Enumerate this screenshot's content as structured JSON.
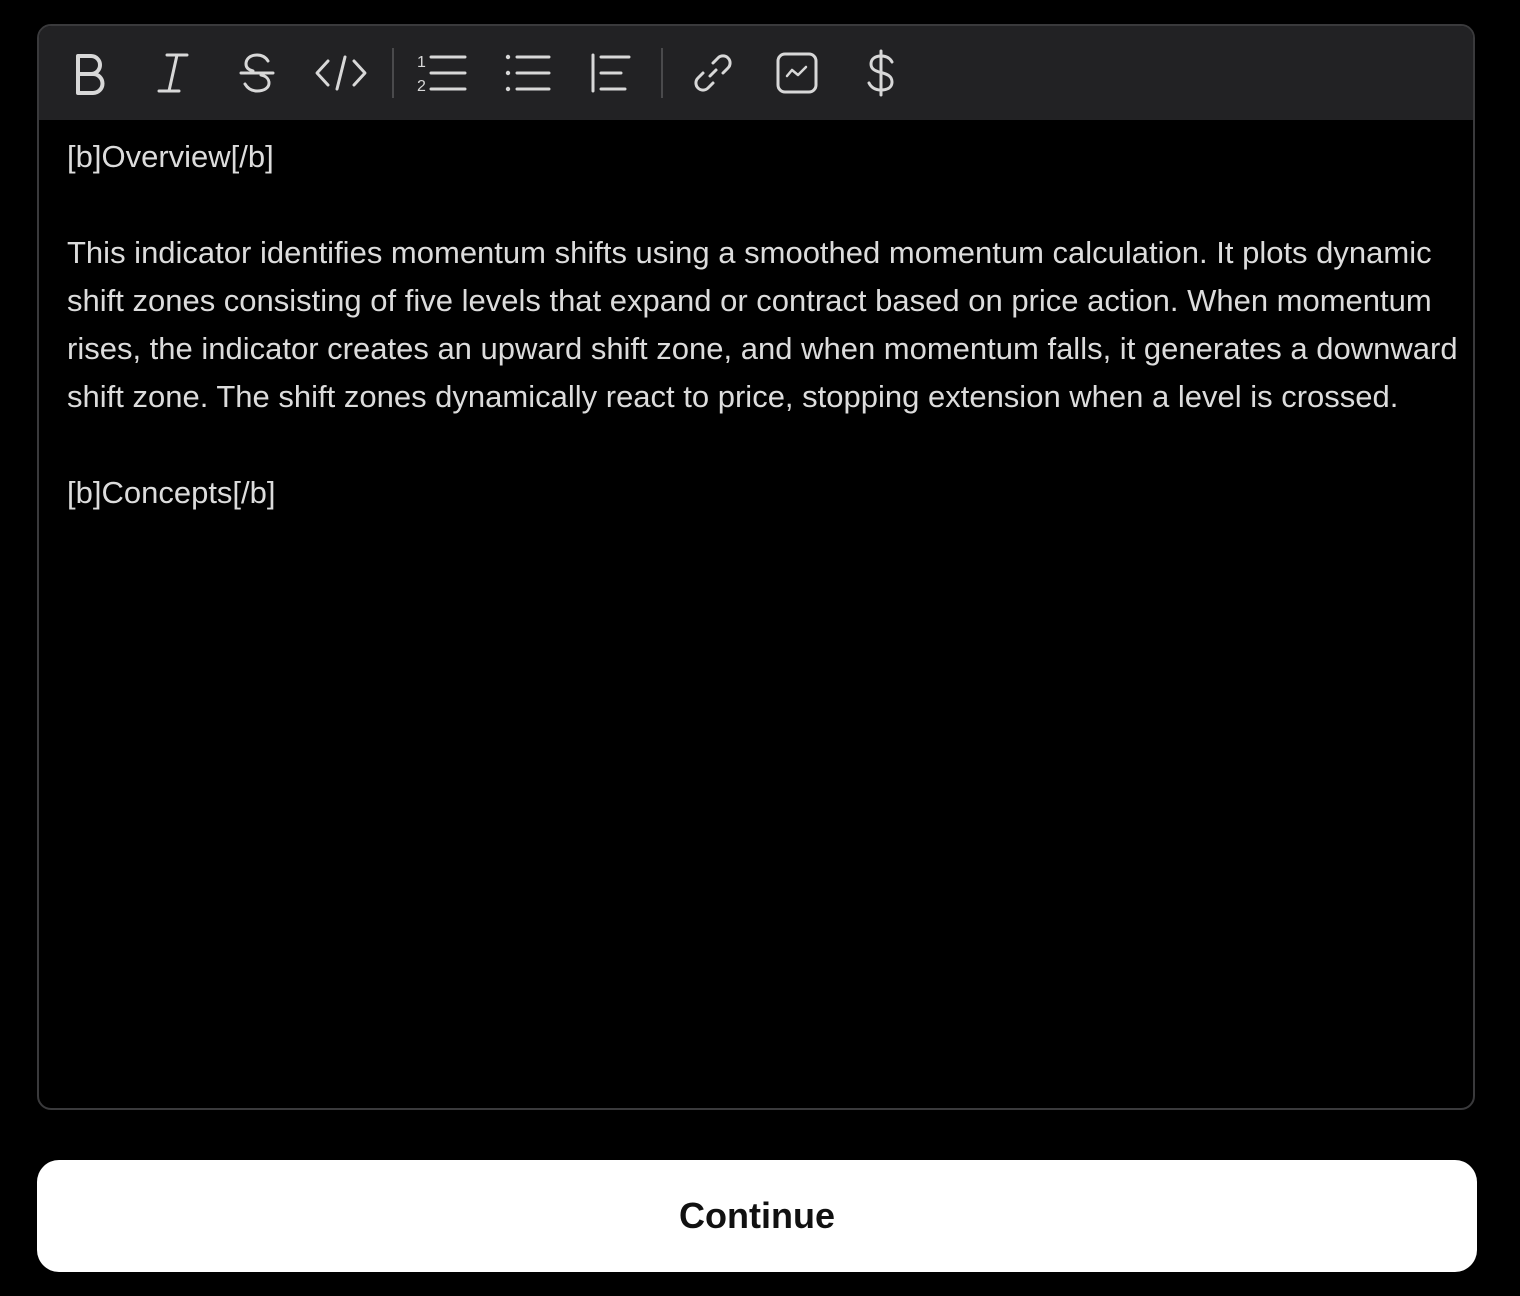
{
  "toolbar": {
    "buttons": [
      {
        "name": "bold",
        "icon": "bold-icon"
      },
      {
        "name": "italic",
        "icon": "italic-icon"
      },
      {
        "name": "strikethrough",
        "icon": "strikethrough-icon"
      },
      {
        "name": "code",
        "icon": "code-icon"
      },
      {
        "name": "numbered-list",
        "icon": "numbered-list-icon"
      },
      {
        "name": "bullet-list",
        "icon": "bullet-list-icon"
      },
      {
        "name": "quote",
        "icon": "blockquote-icon"
      },
      {
        "name": "link",
        "icon": "link-icon"
      },
      {
        "name": "chart",
        "icon": "chart-icon"
      },
      {
        "name": "ticker",
        "icon": "dollar-icon"
      }
    ],
    "numbered_list_digits": [
      "1",
      "2"
    ]
  },
  "editor": {
    "content": "[b]Overview[/b]\n\nThis indicator identifies momentum shifts using a smoothed momentum calculation. It plots dynamic shift zones consisting of five levels that expand or contract based on price action. When momentum rises, the indicator creates an upward shift zone, and when momentum falls, it generates a downward shift zone. The shift zones dynamically react to price, stopping extension when a level is crossed.\n\n[b]Concepts[/b]"
  },
  "footer": {
    "continue_label": "Continue"
  },
  "colors": {
    "background": "#000000",
    "toolbar": "#222224",
    "border": "#3a3a3c",
    "text": "#dcdcdc",
    "button_bg": "#ffffff",
    "button_text": "#111111"
  }
}
